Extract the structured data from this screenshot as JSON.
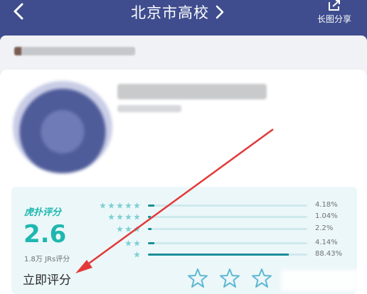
{
  "header": {
    "title": "北京市高校",
    "share_label": "长图分享"
  },
  "rating": {
    "brand": "虎扑评分",
    "score": "2.6",
    "count": "1.8万 JRs评分",
    "rate_now": "立即评分",
    "distribution": [
      {
        "stars": 5,
        "fraction": 0.0418,
        "percent_label": "4.18%"
      },
      {
        "stars": 4,
        "fraction": 0.0104,
        "percent_label": "1.04%"
      },
      {
        "stars": 3,
        "fraction": 0.022,
        "percent_label": "2.2%"
      },
      {
        "stars": 2,
        "fraction": 0.0414,
        "percent_label": "4.14%"
      },
      {
        "stars": 1,
        "fraction": 0.8843,
        "percent_label": "88.43%"
      }
    ]
  },
  "colors": {
    "header_bg": "#3f4d8e",
    "accent": "#1eb7b0",
    "bar_fill": "#1a8f98",
    "annotation_arrow": "#e23a3a"
  },
  "icons": {
    "back": "chevron-left-icon",
    "title_chevron": "chevron-right-icon",
    "share": "share-export-icon",
    "star": "star-outline-icon"
  }
}
